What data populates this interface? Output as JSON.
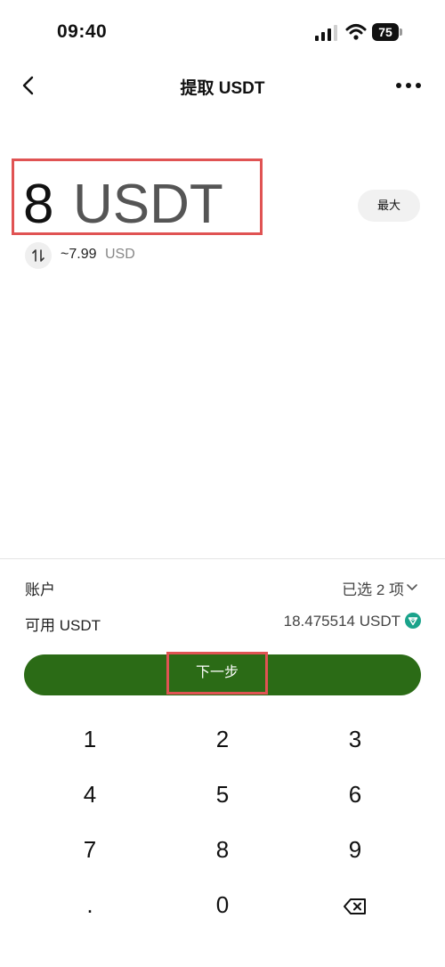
{
  "status_bar": {
    "time": "09:40",
    "battery": "75"
  },
  "header": {
    "title": "提取 USDT"
  },
  "amount": {
    "value": "8",
    "unit": "USDT",
    "max_label": "最大",
    "approx_value": "~7.99",
    "approx_currency": "USD"
  },
  "account": {
    "label": "账户",
    "value": "已选 2 项"
  },
  "available": {
    "label": "可用 USDT",
    "value": "18.475514 USDT"
  },
  "next_button": {
    "label": "下一步"
  },
  "keypad": {
    "keys": [
      "1",
      "2",
      "3",
      "4",
      "5",
      "6",
      "7",
      "8",
      "9",
      ".",
      "0"
    ]
  },
  "icons": {
    "back": "chevron-left-icon",
    "more": "more-horizontal-icon",
    "swap": "swap-vertical-icon",
    "chevron": "chevron-down-icon",
    "tron": "tron-icon",
    "backspace": "backspace-icon"
  },
  "colors": {
    "primary_button": "#2b6b16",
    "highlight_border": "#e05353",
    "tron_badge": "#1aa38b"
  }
}
